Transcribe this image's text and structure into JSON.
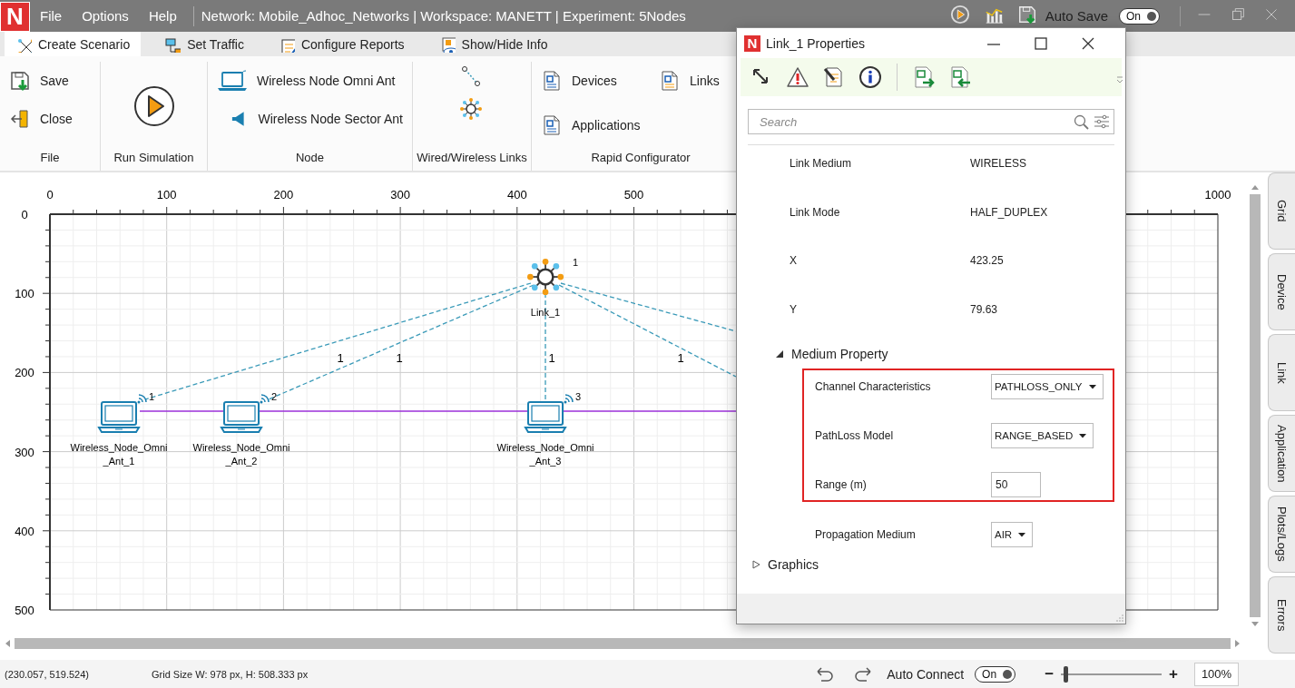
{
  "logo": "N",
  "menu": [
    "File",
    "Options",
    "Help"
  ],
  "title": "Network: Mobile_Adhoc_Networks | Workspace: MANETT | Experiment: 5Nodes",
  "auto_save": {
    "label": "Auto Save",
    "toggle": "On",
    "on": true
  },
  "ribbon_tabs": [
    {
      "label": "Create Scenario",
      "selected": true
    },
    {
      "label": "Set Traffic",
      "selected": false
    },
    {
      "label": "Configure Reports",
      "selected": false
    },
    {
      "label": "Show/Hide Info",
      "selected": false
    }
  ],
  "ribbon_groups": [
    {
      "label": "File",
      "kind": "list",
      "items": [
        "Save",
        "Close"
      ]
    },
    {
      "label": "Run Simulation",
      "kind": "play"
    },
    {
      "label": "Node",
      "kind": "list",
      "items": [
        "Wireless Node Omni Ant",
        "Wireless Node Sector Ant"
      ]
    },
    {
      "label": "Wired/Wireless Links",
      "kind": "tools"
    },
    {
      "label": "Rapid Configurator",
      "kind": "grid",
      "items": [
        "Devices",
        "Links",
        "Applications"
      ]
    }
  ],
  "canvas": {
    "x_ruler": [
      "0",
      "100",
      "200",
      "300",
      "400",
      "500",
      "1000"
    ],
    "y_ruler": [
      "0",
      "100",
      "200",
      "300",
      "400",
      "500"
    ],
    "hub": {
      "name": "Link_1",
      "number": "1"
    },
    "nodes": [
      {
        "name": "Wireless_Node_Omni\n_Ant_1",
        "number": "1"
      },
      {
        "name": "Wireless_Node_Omni\n_Ant_2",
        "number": "2"
      },
      {
        "name": "Wireless_Node_Omni\n_Ant_3",
        "number": "3"
      }
    ],
    "link_labels": [
      "1",
      "1",
      "1",
      "1"
    ]
  },
  "side_tabs": [
    "Grid",
    "Device",
    "Link",
    "Application",
    "Plots/Logs",
    "Errors"
  ],
  "dialog": {
    "logo": "N",
    "title": "Link_1 Properties",
    "search": {
      "placeholder": "Search"
    },
    "properties": [
      {
        "label": "Link Medium",
        "value": "WIRELESS"
      },
      {
        "label": "Link Mode",
        "value": "HALF_DUPLEX"
      },
      {
        "label": "X",
        "value": "423.25"
      },
      {
        "label": "Y",
        "value": "79.63"
      }
    ],
    "sections": [
      {
        "label": "Medium Property",
        "expanded": true,
        "highlighted_rows": [
          {
            "label": "Channel Characteristics",
            "kind": "dropdown",
            "value": "PATHLOSS_ONLY"
          },
          {
            "label": "PathLoss Model",
            "kind": "dropdown",
            "value": "RANGE_BASED"
          },
          {
            "label": "Range (m)",
            "kind": "input",
            "value": "50"
          }
        ],
        "rows": [
          {
            "label": "Propagation Medium",
            "kind": "dropdown",
            "value": "AIR"
          }
        ]
      },
      {
        "label": "Graphics",
        "expanded": false
      }
    ]
  },
  "status": {
    "cursor": "(230.057, 519.524)",
    "grid_size": "Grid Size W: 978 px, H: 508.333 px",
    "auto_connect": {
      "label": "Auto Connect",
      "toggle": "On",
      "on": true
    },
    "zoom": {
      "minus": "−",
      "plus": "+",
      "level": 0.03,
      "value": "100%"
    }
  }
}
